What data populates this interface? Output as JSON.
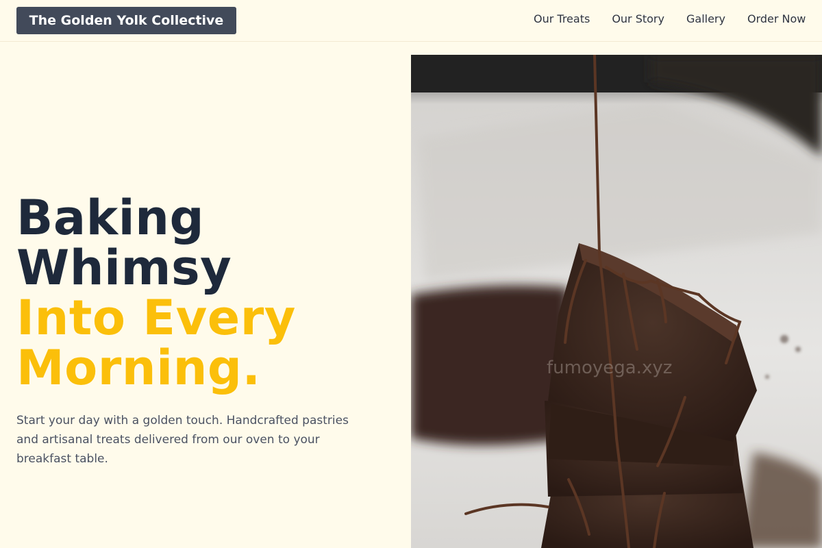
{
  "header": {
    "brand": "The Golden Yolk Collective",
    "nav": [
      {
        "label": "Our Treats"
      },
      {
        "label": "Our Story"
      },
      {
        "label": "Gallery"
      },
      {
        "label": "Order Now"
      }
    ]
  },
  "hero": {
    "headline_dark": [
      "Baking",
      "Whimsy"
    ],
    "headline_gold": [
      "Into Every",
      "Morning."
    ],
    "subtext": "Start your day with a golden touch. Handcrafted pastries and artisanal treats delivered from our oven to your breakfast table.",
    "image": {
      "subject": "chocolate-brownie-stack-with-drizzle",
      "watermark": "fumoyega.xyz"
    }
  },
  "colors": {
    "background": "#fffbeb",
    "brand_bg": "#424a5a",
    "headline_dark": "#1e293b",
    "headline_gold": "#fbbf0a",
    "body_text": "#4b5262"
  }
}
